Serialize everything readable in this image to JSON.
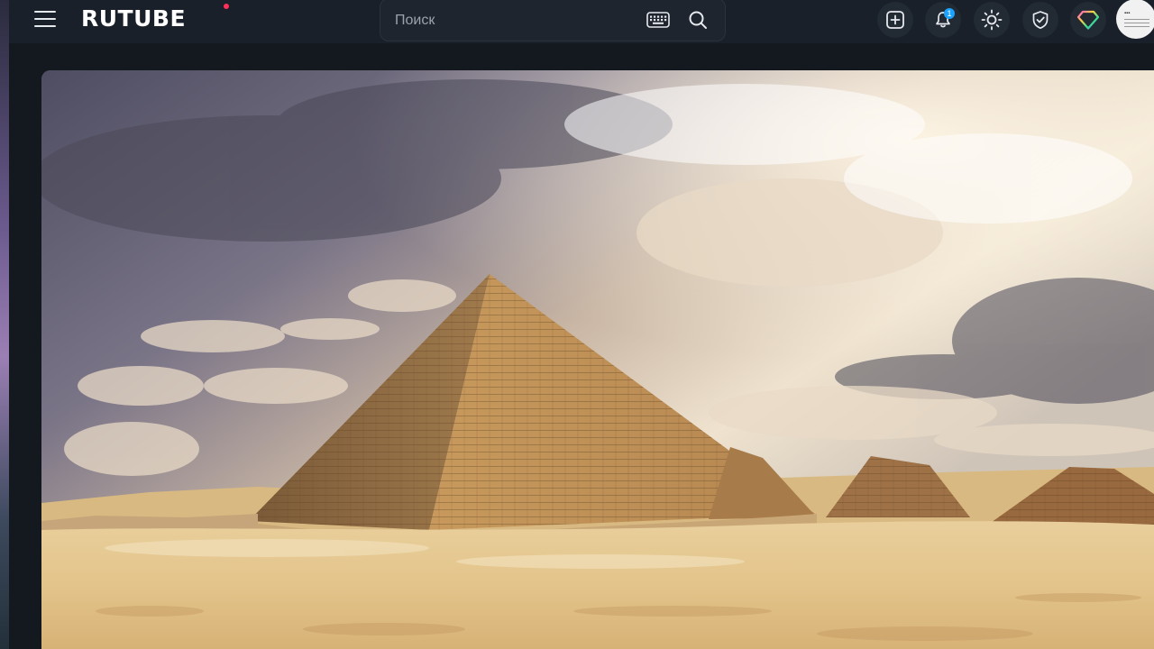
{
  "header": {
    "logo_text": "RUTUBE",
    "search": {
      "placeholder": "Поиск",
      "value": ""
    },
    "notifications_count": "1"
  },
  "icons": {
    "menu": "hamburger-menu-icon",
    "keyboard": "keyboard-icon",
    "search": "search-icon",
    "upload": "add-video-icon",
    "notifications": "bell-icon",
    "theme": "sun-icon",
    "shield": "shield-check-icon",
    "premium": "diamond-icon"
  },
  "colors": {
    "header_bg": "#1a2029",
    "page_bg": "#14191f",
    "accent_dot": "#ff2e5a",
    "badge": "#1aa3ff"
  },
  "video": {
    "scene": "pyramids"
  }
}
